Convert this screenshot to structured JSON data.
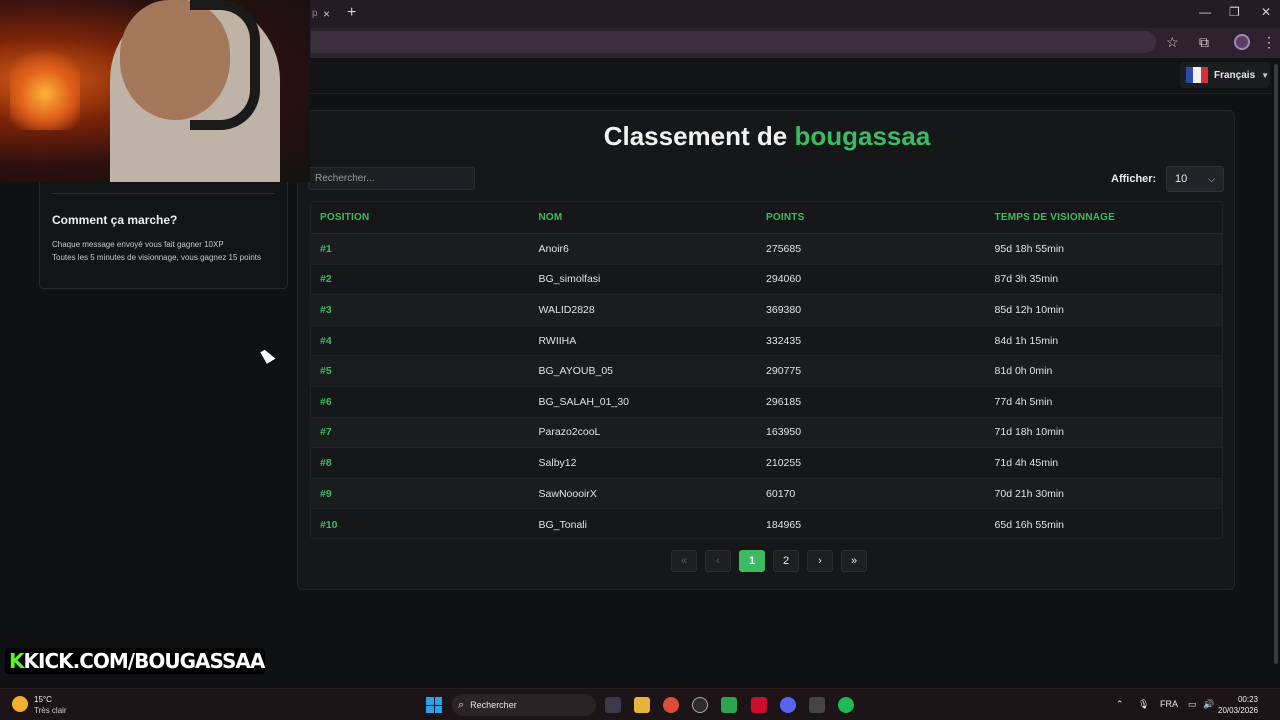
{
  "browser": {
    "tab_close": "×",
    "tab_fragment": "p",
    "new_tab": "+",
    "minimize": "—",
    "restore": "❐",
    "close": "✕"
  },
  "topnav": {
    "language": "Français"
  },
  "sidebar": {
    "title": "Comment ça marche?",
    "lines": [
      "Chaque message envoyé vous fait gagner 10XP",
      "Toutes les 5 minutes de visionnage, vous gagnez 15 points"
    ]
  },
  "leaderboard": {
    "title_prefix": "Classement de",
    "title_user": "bougassaa",
    "search_placeholder": "Rechercher...",
    "show_label": "Afficher:",
    "show_value": "10",
    "columns": [
      "POSITION",
      "NOM",
      "POINTS",
      "TEMPS DE VISIONNAGE"
    ],
    "rows": [
      [
        "#1",
        "Anoir6",
        "275685",
        "95d 18h 55min"
      ],
      [
        "#2",
        "BG_simolfasi",
        "294060",
        "87d 3h 35min"
      ],
      [
        "#3",
        "WALID2828",
        "369380",
        "85d 12h 10min"
      ],
      [
        "#4",
        "RWIIHA",
        "332435",
        "84d 1h 15min"
      ],
      [
        "#5",
        "BG_AYOUB_05",
        "290775",
        "81d 0h 0min"
      ],
      [
        "#6",
        "BG_SALAH_01_30",
        "296185",
        "77d 4h 5min"
      ],
      [
        "#7",
        "Parazo2cooL",
        "163950",
        "71d 18h 10min"
      ],
      [
        "#8",
        "Salby12",
        "210255",
        "71d 4h 45min"
      ],
      [
        "#9",
        "SawNoooirX",
        "60170",
        "70d 21h 30min"
      ],
      [
        "#10",
        "BG_Tonali",
        "184965",
        "65d 16h 55min"
      ]
    ],
    "pagination": {
      "first": "«",
      "prev": "‹",
      "pages": [
        "1",
        "2"
      ],
      "next": "›",
      "last": "»"
    }
  },
  "overlay": {
    "kick_k": "K",
    "kick_rest": "KICK.COM/BOUGASSAA"
  },
  "taskbar": {
    "temperature": "15°C",
    "weather": "Très clair",
    "search": "Rechercher",
    "lang": "FRA",
    "time": "00:23",
    "date": "20/03/2026"
  },
  "colors": {
    "accent": "#3dbb62",
    "kick": "#53fc18"
  }
}
